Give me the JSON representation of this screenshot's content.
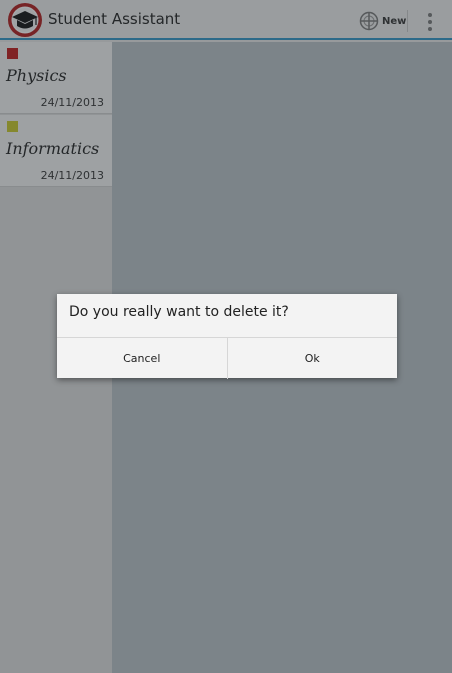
{
  "actionbar": {
    "title": "Student Assistant",
    "new_label": "New",
    "app_icon": "graduation-cap-icon",
    "new_icon": "add-circle-icon",
    "overflow_icon": "overflow-menu-icon"
  },
  "list": {
    "items": [
      {
        "subject": "Physics",
        "date": "24/11/2013",
        "color": "#c01a1a"
      },
      {
        "subject": "Informatics",
        "date": "24/11/2013",
        "color": "#c9c92a"
      }
    ]
  },
  "dialog": {
    "message": "Do you really want to delete it?",
    "cancel_label": "Cancel",
    "ok_label": "Ok"
  },
  "colors": {
    "accent": "#2f95c6",
    "icon_ring": "#b01c1c"
  }
}
